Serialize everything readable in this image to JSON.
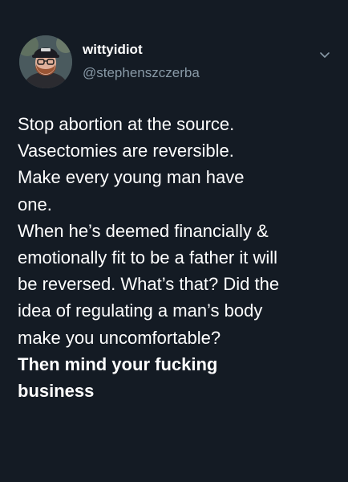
{
  "tweet": {
    "display_name": "wittyidiot",
    "handle": "@stephenszczerba",
    "icons": {
      "avatar": "profile-photo",
      "menu": "chevron-down-icon"
    },
    "lines": [
      "Stop abortion at the source.",
      "Vasectomies are reversible.",
      "Make every young man have",
      "one.",
      "When he’s deemed financially &",
      "emotionally fit to be a father it will",
      "be reversed. What’s that? Did the",
      "idea of regulating a man’s body",
      "make you uncomfortable?"
    ],
    "bold_lines": [
      "Then mind your fucking",
      "business"
    ]
  },
  "colors": {
    "background": "#141b24",
    "text": "#ffffff",
    "secondary_text": "#8899a6"
  }
}
